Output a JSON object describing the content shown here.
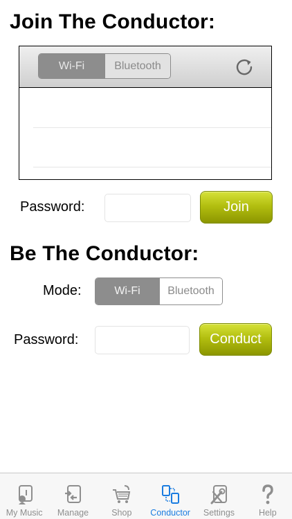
{
  "join": {
    "title": "Join The Conductor:",
    "segment": {
      "selected": "Wi-Fi",
      "options": [
        "Wi-Fi",
        "Bluetooth"
      ]
    },
    "password_label": "Password:",
    "password_value": "",
    "join_label": "Join"
  },
  "conduct": {
    "title": "Be The Conductor:",
    "mode_label": "Mode:",
    "segment": {
      "selected": "Wi-Fi",
      "options": [
        "Wi-Fi",
        "Bluetooth"
      ]
    },
    "password_label": "Password:",
    "password_value": "",
    "conduct_label": "Conduct"
  },
  "tabbar": {
    "items": [
      {
        "label": "My Music",
        "icon": "my-music-icon"
      },
      {
        "label": "Manage",
        "icon": "manage-icon"
      },
      {
        "label": "Shop",
        "icon": "shop-cart-icon"
      },
      {
        "label": "Conductor",
        "icon": "conductor-icon"
      },
      {
        "label": "Settings",
        "icon": "settings-tools-icon"
      },
      {
        "label": "Help",
        "icon": "help-icon"
      }
    ],
    "active": "Conductor"
  },
  "colors": {
    "accent": "#1a7ce0",
    "button_olive": "#b3bf10",
    "segment_selected": "#8d8d8d"
  }
}
